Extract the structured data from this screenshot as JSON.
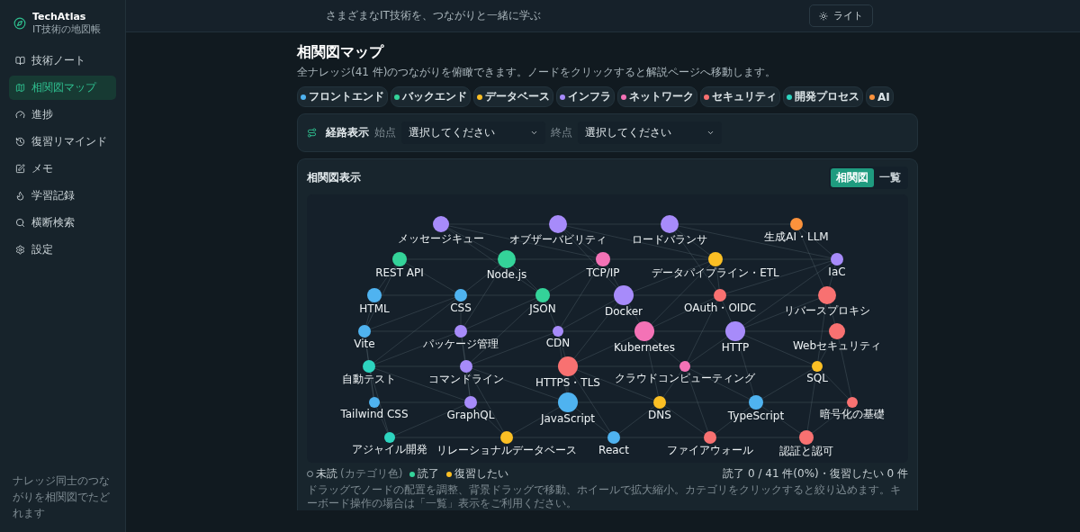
{
  "brand": {
    "name": "TechAtlas",
    "tagline": "IT技術の地図帳"
  },
  "sidebar": {
    "items": [
      {
        "label": "技術ノート",
        "selected": false
      },
      {
        "label": "相関図マップ",
        "selected": true
      },
      {
        "label": "進捗",
        "selected": false
      },
      {
        "label": "復習リマインド",
        "selected": false
      },
      {
        "label": "メモ",
        "selected": false
      },
      {
        "label": "学習記録",
        "selected": false
      },
      {
        "label": "横断検索",
        "selected": false
      },
      {
        "label": "設定",
        "selected": false
      }
    ],
    "footer": "ナレッジ同士のつながりを相関図でたどれます"
  },
  "header": {
    "tagline": "さまざまなIT技術を、つながりと一緒に学ぶ",
    "theme_button": "ライト"
  },
  "page": {
    "title": "相関図マップ",
    "description": "全ナレッジ(41 件)のつながりを俯瞰できます。ノードをクリックすると解説ページへ移動します。"
  },
  "categories": [
    {
      "label": "フロントエンド",
      "color": "#4fb3f0"
    },
    {
      "label": "バックエンド",
      "color": "#34d399"
    },
    {
      "label": "データベース",
      "color": "#fbbf24"
    },
    {
      "label": "インフラ",
      "color": "#a78bfa"
    },
    {
      "label": "ネットワーク",
      "color": "#f472b6"
    },
    {
      "label": "セキュリティ",
      "color": "#f87171"
    },
    {
      "label": "開発プロセス",
      "color": "#2dd4bf"
    },
    {
      "label": "AI",
      "color": "#fb923c"
    }
  ],
  "route": {
    "title": "経路表示",
    "start_label": "始点",
    "start_value": "選択してください",
    "end_label": "終点",
    "end_value": "選択してください"
  },
  "graph": {
    "title": "相関図表示",
    "views": [
      {
        "label": "相関図",
        "selected": true
      },
      {
        "label": "一覧",
        "selected": false
      }
    ],
    "nodes": [
      {
        "label": "メッセージキュー",
        "color": "#a78bfa"
      },
      {
        "label": "オブザーバビリティ",
        "color": "#a78bfa"
      },
      {
        "label": "ロードバランサ",
        "color": "#a78bfa"
      },
      {
        "label": "生成AI・LLM",
        "color": "#fb923c"
      },
      {
        "label": "REST API",
        "color": "#34d399"
      },
      {
        "label": "Node.js",
        "color": "#34d399"
      },
      {
        "label": "TCP/IP",
        "color": "#f472b6"
      },
      {
        "label": "データパイプライン・ETL",
        "color": "#fbbf24"
      },
      {
        "label": "IaC",
        "color": "#a78bfa"
      },
      {
        "label": "HTML",
        "color": "#4fb3f0"
      },
      {
        "label": "CSS",
        "color": "#4fb3f0"
      },
      {
        "label": "JSON",
        "color": "#34d399"
      },
      {
        "label": "Docker",
        "color": "#a78bfa"
      },
      {
        "label": "OAuth・OIDC",
        "color": "#f87171"
      },
      {
        "label": "リバースプロキシ",
        "color": "#f87171"
      },
      {
        "label": "Vite",
        "color": "#4fb3f0"
      },
      {
        "label": "パッケージ管理",
        "color": "#a78bfa"
      },
      {
        "label": "CDN",
        "color": "#a78bfa"
      },
      {
        "label": "Kubernetes",
        "color": "#f472b6"
      },
      {
        "label": "HTTP",
        "color": "#a78bfa"
      },
      {
        "label": "Webセキュリティ",
        "color": "#f87171"
      },
      {
        "label": "自動テスト",
        "color": "#2dd4bf"
      },
      {
        "label": "コマンドライン",
        "color": "#a78bfa"
      },
      {
        "label": "HTTPS・TLS",
        "color": "#f87171"
      },
      {
        "label": "クラウドコンピューティング",
        "color": "#f472b6"
      },
      {
        "label": "SQL",
        "color": "#fbbf24"
      },
      {
        "label": "Tailwind CSS",
        "color": "#4fb3f0"
      },
      {
        "label": "GraphQL",
        "color": "#a78bfa"
      },
      {
        "label": "JavaScript",
        "color": "#4fb3f0"
      },
      {
        "label": "DNS",
        "color": "#fbbf24"
      },
      {
        "label": "TypeScript",
        "color": "#4fb3f0"
      },
      {
        "label": "暗号化の基礎",
        "color": "#f87171"
      },
      {
        "label": "アジャイル開発",
        "color": "#2dd4bf"
      },
      {
        "label": "リレーショナルデータベース",
        "color": "#fbbf24"
      },
      {
        "label": "React",
        "color": "#4fb3f0"
      },
      {
        "label": "ファイアウォール",
        "color": "#f87171"
      },
      {
        "label": "認証と認可",
        "color": "#f87171"
      }
    ],
    "legend": [
      {
        "label": "未読",
        "note": "(カテゴリ色)",
        "kind": "unread"
      },
      {
        "label": "読了",
        "kind": "done",
        "color": "#34d399"
      },
      {
        "label": "復習したい",
        "kind": "review",
        "color": "#fbbf24"
      }
    ],
    "stats": "読了 0 / 41 件(0%)・復習したい 0 件",
    "hint": "ドラッグでノードの配置を調整、背景ドラッグで移動、ホイールで拡大縮小。カテゴリをクリックすると絞り込めます。キーボード操作の場合は「一覧」表示をご利用ください。"
  }
}
